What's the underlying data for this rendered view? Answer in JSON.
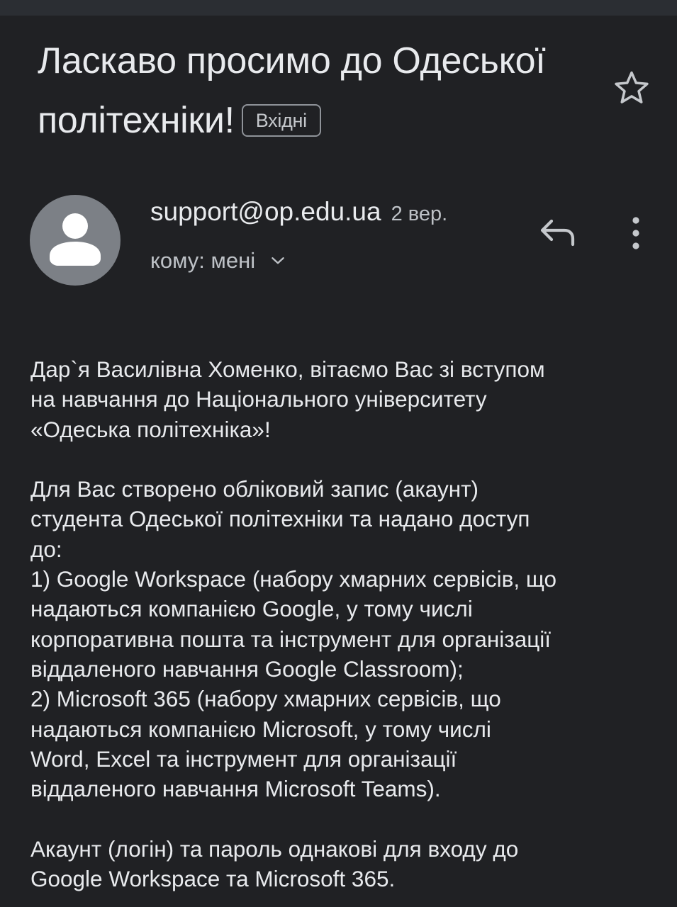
{
  "email": {
    "subject": "Ласкаво просимо до Одеської політехніки!",
    "label": "Вхідні",
    "sender": "support@op.edu.ua",
    "date": "2 вер.",
    "recipient": "кому: мені"
  },
  "icons": {
    "star": "star-outline-icon",
    "avatar": "person-icon",
    "reply": "reply-arrow-icon",
    "more": "more-vert-icon",
    "expand": "chevron-down-icon"
  },
  "body": {
    "greeting": [
      "Дар`я Василівна Хоменко, вітаємо Вас зі вступом",
      "на навчання до Національного університету",
      "«Одеська політехніка»!"
    ],
    "account": [
      "Для Вас створено обліковий запис (акаунт)",
      "студента Одеської політехніки та надано доступ",
      "до:",
      "1) Google Workspace (набору хмарних сервісів, що",
      "надаються компанією Google, у тому числі",
      "корпоративна пошта та інструмент для організації",
      "віддаленого навчання Google Classroom);",
      "2) Microsoft 365 (набору хмарних сервісів, що",
      "надаються компанією Microsoft, у тому числі",
      "Word, Excel та інструмент для організації",
      "віддаленого навчання Microsoft Teams)."
    ],
    "login": [
      "Акаунт (логін) та пароль однакові для входу до",
      "Google Workspace та Microsoft 365."
    ]
  },
  "colors": {
    "background": "#202124",
    "text": "#e8eaed",
    "secondary_text": "#bdc1c6",
    "avatar": "#7c8086"
  }
}
